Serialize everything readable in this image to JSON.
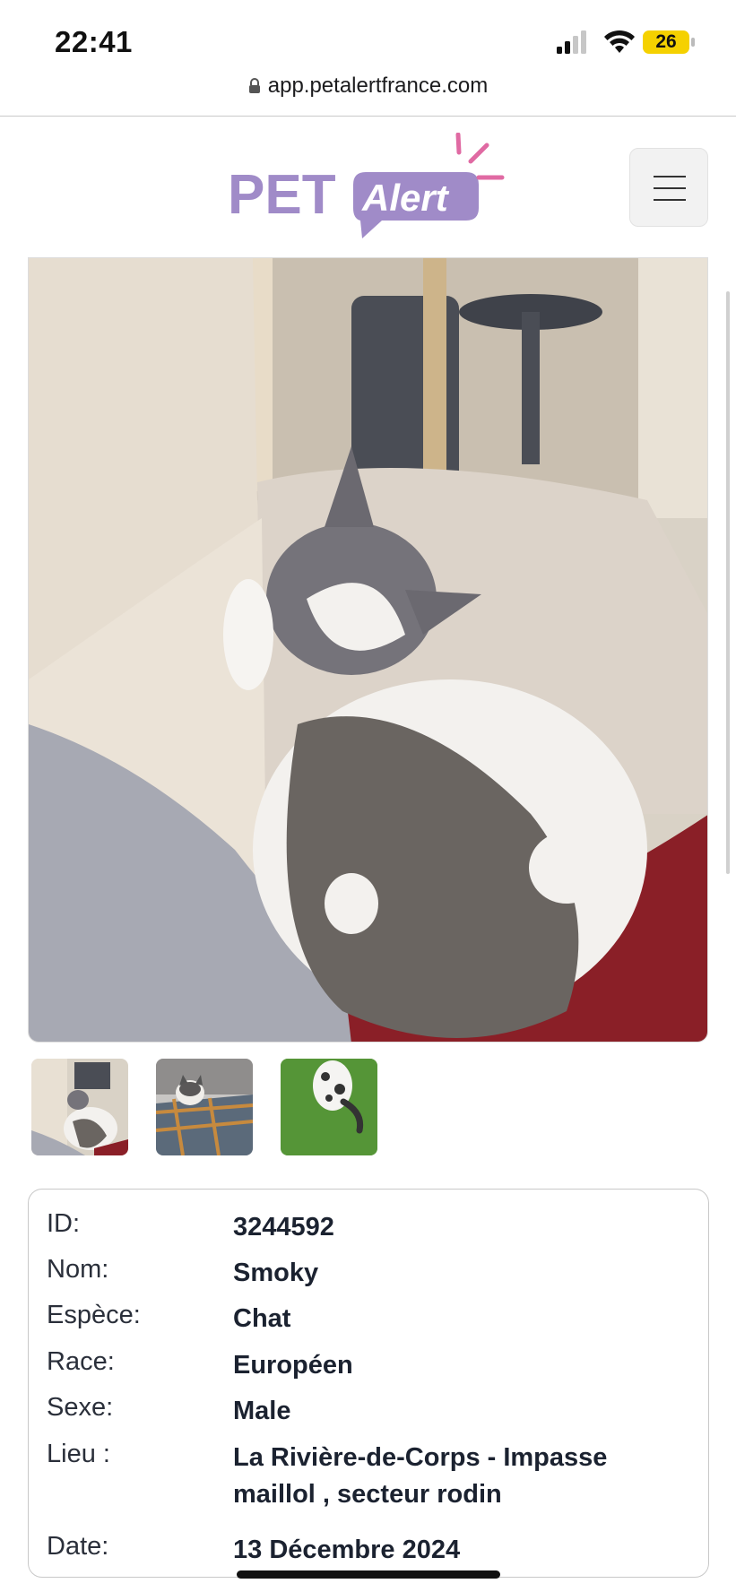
{
  "status_bar": {
    "time": "22:41",
    "battery": "26",
    "icons": [
      "signal-icon",
      "wifi-icon",
      "battery-icon"
    ]
  },
  "browser": {
    "url": "app.petalertfrance.com"
  },
  "header": {
    "logo_pet": "PET",
    "logo_alert": "Alert",
    "menu_icon": "hamburger-menu-icon"
  },
  "colors": {
    "brand_purple": "#a08bc8",
    "accent_pink": "#e06aa3",
    "text_dark": "#1b2230"
  },
  "gallery": {
    "main_photo": "cat-photo-sleeping",
    "thumbnails": [
      "thumb-cat-sleeping",
      "thumb-cat-blanket",
      "thumb-cat-grass"
    ]
  },
  "details": [
    {
      "label": "ID:",
      "value": "3244592"
    },
    {
      "label": "Nom:",
      "value": "Smoky"
    },
    {
      "label": "Espèce:",
      "value": "Chat"
    },
    {
      "label": "Race:",
      "value": "Européen"
    },
    {
      "label": "Sexe:",
      "value": "Male"
    },
    {
      "label": "Lieu :",
      "value": "La Rivière-de-Corps -  Impasse maillol , secteur rodin"
    },
    {
      "label": "Date:",
      "value": "13 Décembre 2024"
    }
  ]
}
